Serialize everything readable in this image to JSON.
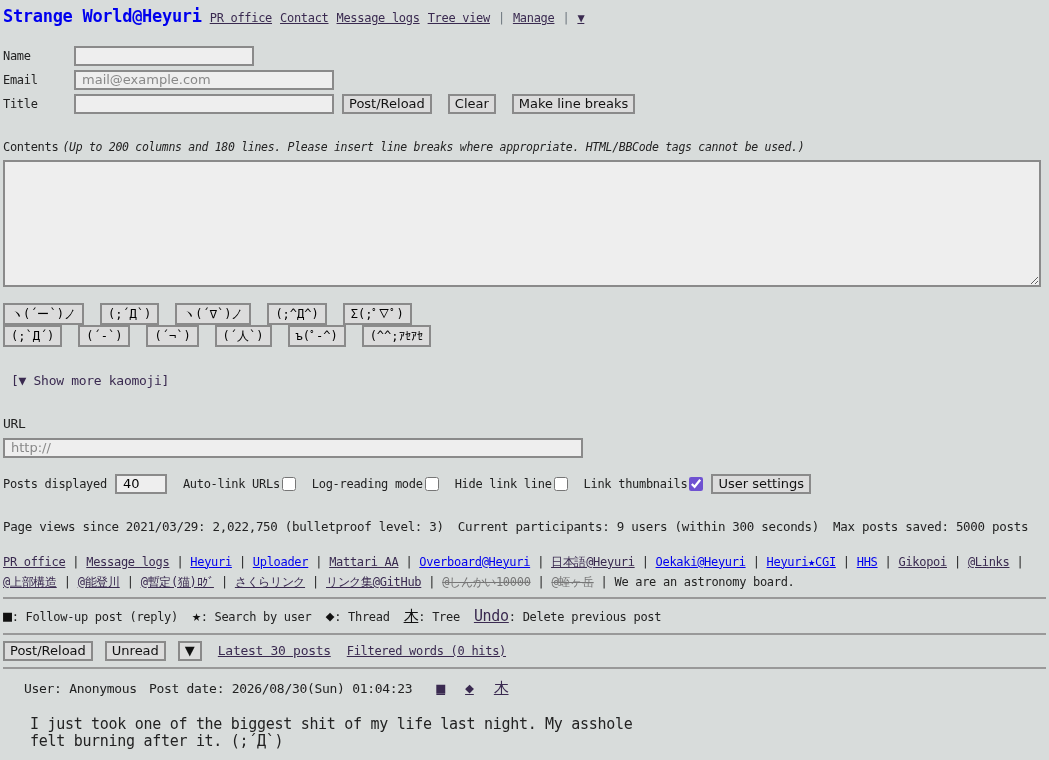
{
  "header": {
    "title": "Strange World@Heyuri",
    "items": [
      {
        "kind": "link",
        "text": "PR office"
      },
      {
        "kind": "link",
        "text": "Contact"
      },
      {
        "kind": "link",
        "text": "Message logs"
      },
      {
        "kind": "link",
        "text": "Tree view"
      },
      {
        "kind": "sep",
        "text": "|"
      },
      {
        "kind": "link",
        "text": "Manage"
      },
      {
        "kind": "sep",
        "text": "|"
      },
      {
        "kind": "link",
        "text": "▼"
      }
    ]
  },
  "form": {
    "fields": [
      {
        "label": "Name"
      },
      {
        "label": "Email",
        "placeholder": "mail@example.com"
      },
      {
        "label": "Title"
      }
    ],
    "buttons": [
      "Post/Reload",
      "Clear",
      "Make line breaks"
    ],
    "contents_label": "Contents",
    "contents_hint": "(Up to 200 columns and 180 lines. Please insert line breaks where appropriate. HTML/BBCode tags cannot be used.)"
  },
  "kaomoji": [
    [
      "ヽ(´ー`)ノ",
      "(;´Д`)",
      "ヽ(´∇`)ノ",
      "(;^Д^)",
      "Σ(;ﾟ∇ﾟ)"
    ],
    [
      "(;`Д´)",
      "(´-`)",
      "(´¬`)",
      "(´人`)",
      "ъ(ﾟ-^)",
      "(^^;ｱｾｱｾ"
    ]
  ],
  "show_more": "[▼ Show more kaomoji]",
  "url": {
    "label": "URL",
    "placeholder": "http://"
  },
  "settings": {
    "posts_label": "Posts displayed",
    "posts_value": "40",
    "checkboxes": [
      {
        "label": "Auto-link URLs",
        "checked": false
      },
      {
        "label": "Log-reading mode",
        "checked": false
      },
      {
        "label": "Hide link line",
        "checked": false
      },
      {
        "label": "Link thumbnails",
        "checked": true
      }
    ],
    "button": "User settings"
  },
  "stats": [
    "Page views since 2021/03/29: 2,022,750 (bulletproof level: 3)",
    "Current participants: 9 users (within 300 seconds)",
    "Max posts saved: 5000 posts"
  ],
  "footer_links": [
    {
      "kind": "visited",
      "text": "PR office"
    },
    {
      "kind": "sep",
      "text": "|"
    },
    {
      "kind": "visited",
      "text": "Message logs"
    },
    {
      "kind": "sep",
      "text": "|"
    },
    {
      "kind": "unvisited",
      "text": "Heyuri"
    },
    {
      "kind": "sep",
      "text": "|"
    },
    {
      "kind": "unvisited",
      "text": "Uploader"
    },
    {
      "kind": "sep",
      "text": "|"
    },
    {
      "kind": "visited",
      "text": "Mattari AA"
    },
    {
      "kind": "sep",
      "text": "|"
    },
    {
      "kind": "unvisited",
      "text": "Overboard@Heyuri"
    },
    {
      "kind": "sep",
      "text": "|"
    },
    {
      "kind": "visited",
      "text": "日本語@Heyuri"
    },
    {
      "kind": "sep",
      "text": "|"
    },
    {
      "kind": "unvisited",
      "text": "Oekaki@Heyuri"
    },
    {
      "kind": "sep",
      "text": "|"
    },
    {
      "kind": "unvisited",
      "text": "Heyuri★CGI"
    },
    {
      "kind": "sep",
      "text": "|"
    },
    {
      "kind": "unvisited",
      "text": "HHS"
    },
    {
      "kind": "sep",
      "text": "|"
    },
    {
      "kind": "visited",
      "text": "Gikopoi"
    },
    {
      "kind": "sep",
      "text": "|"
    },
    {
      "kind": "visited",
      "text": "@Links"
    },
    {
      "kind": "sep",
      "text": "|"
    },
    {
      "kind": "visited",
      "text": "@上部構造"
    },
    {
      "kind": "sep",
      "text": "|"
    },
    {
      "kind": "visited",
      "text": "@能登川"
    },
    {
      "kind": "sep",
      "text": "|"
    },
    {
      "kind": "visited",
      "text": "@暫定(猫)ﾛｸﾞ"
    },
    {
      "kind": "sep",
      "text": "|"
    },
    {
      "kind": "visited",
      "text": "さくらリンク"
    },
    {
      "kind": "sep",
      "text": "|"
    },
    {
      "kind": "visited",
      "text": "リンク集@GitHub"
    },
    {
      "kind": "sep",
      "text": "|"
    },
    {
      "kind": "struck",
      "text": "@しんかい10000"
    },
    {
      "kind": "sep",
      "text": "|"
    },
    {
      "kind": "struck",
      "text": "@蛭ヶ岳"
    },
    {
      "kind": "sep",
      "text": "|"
    },
    {
      "kind": "text",
      "text": "We are an astronomy board."
    }
  ],
  "legend": [
    {
      "symbol": "■",
      "label": ": Follow-up post (reply)"
    },
    {
      "symbol": "★",
      "label": ": Search by user"
    },
    {
      "symbol": "◆",
      "label": ": Thread"
    },
    {
      "symbol": "木",
      "label": ": Tree"
    },
    {
      "symbol": "Undo",
      "label": ": Delete previous post"
    }
  ],
  "toolbar": {
    "buttons": [
      "Post/Reload",
      "Unread",
      "▼"
    ],
    "links": [
      "Latest 30 posts",
      "Filtered words (0 hits)"
    ]
  },
  "post": {
    "user": "User: Anonymous",
    "date": "Post date: 2026/08/30(Sun) 01:04:23",
    "actions": [
      "■",
      "◆",
      "木"
    ],
    "body": [
      "I just took one of the biggest shit of my life last night. My asshole",
      "felt burning after it. (;´Д`)"
    ]
  }
}
